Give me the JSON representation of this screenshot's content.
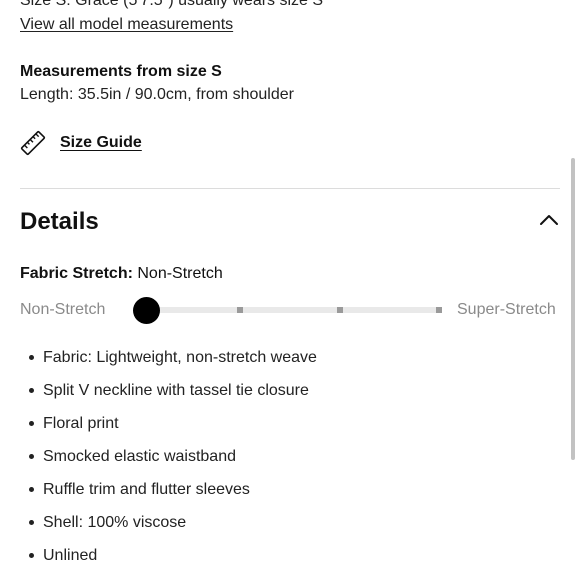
{
  "model": {
    "size_line": "Size S: Grace (5'7.5\") usually wears size S",
    "measurements_link": "View all model measurements"
  },
  "measurements": {
    "title": "Measurements from size S",
    "length": "Length: 35.5in / 90.0cm, from shoulder"
  },
  "size_guide": {
    "label": "Size Guide",
    "icon": "ruler-icon"
  },
  "details": {
    "title": "Details",
    "toggle_icon": "chevron-up-icon",
    "expanded": true,
    "fabric_stretch": {
      "label": "Fabric Stretch:",
      "value": "Non-Stretch",
      "scale_min": "Non-Stretch",
      "scale_max": "Super-Stretch",
      "level_index": 0,
      "level_count": 4
    },
    "bullets": [
      "Fabric: Lightweight, non-stretch weave",
      "Split V neckline with tassel tie closure",
      "Floral print",
      "Smocked elastic waistband",
      "Ruffle trim and flutter sleeves",
      "Shell: 100% viscose",
      "Unlined"
    ]
  }
}
